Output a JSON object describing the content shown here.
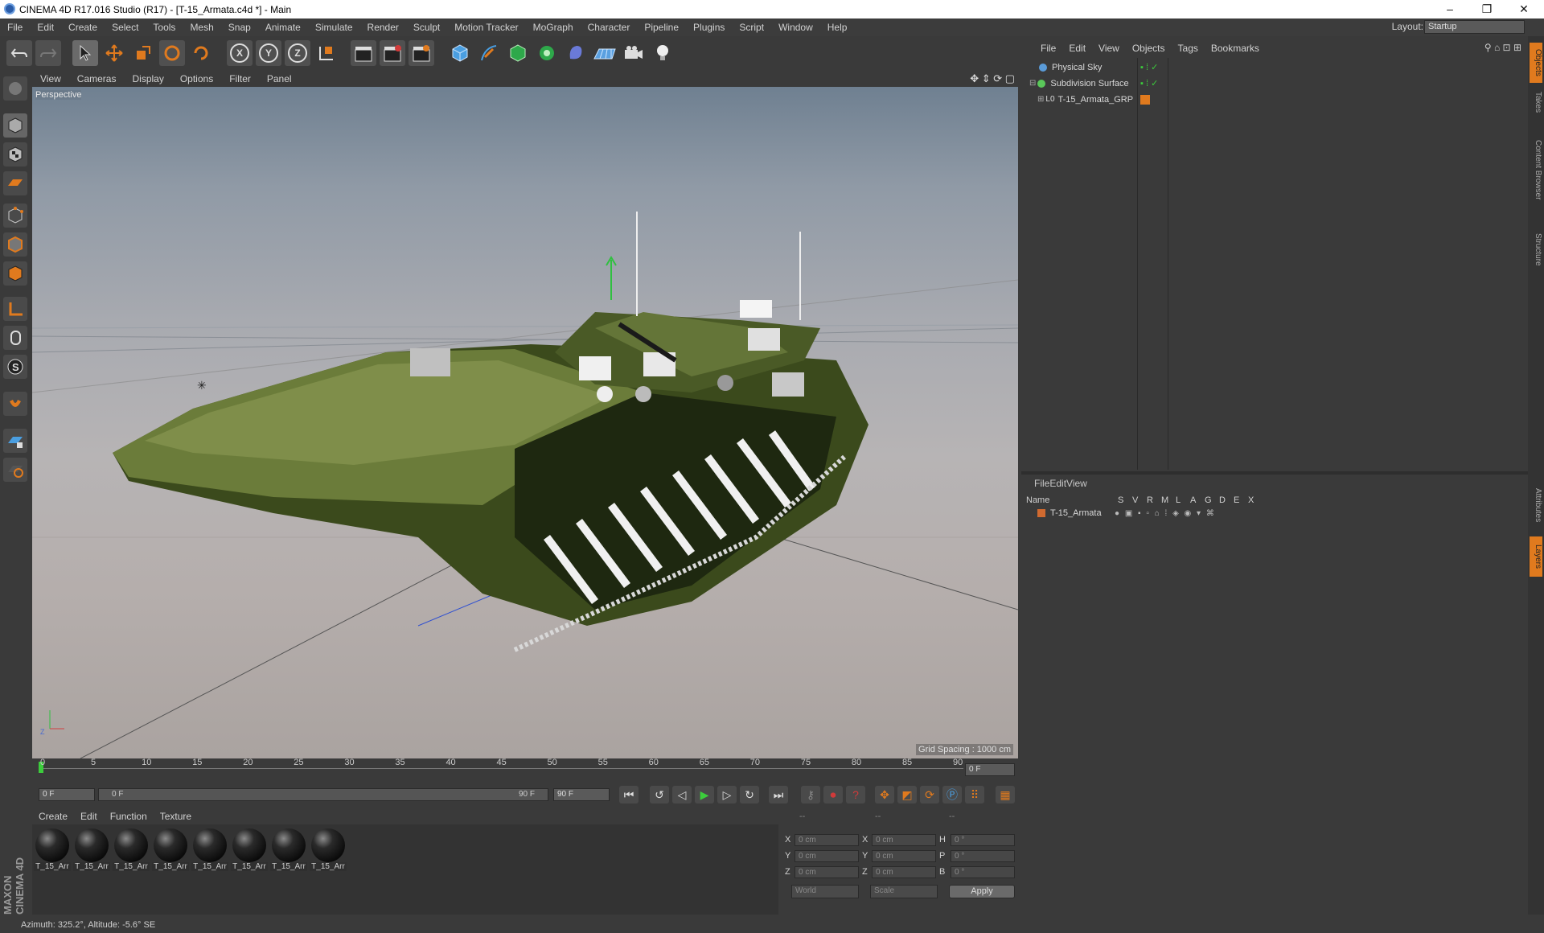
{
  "window": {
    "title": "CINEMA 4D R17.016 Studio (R17) - [T-15_Armata.c4d *] - Main",
    "minimize": "–",
    "maximize": "❐",
    "close": "✕"
  },
  "menubar": [
    "File",
    "Edit",
    "Create",
    "Select",
    "Tools",
    "Mesh",
    "Snap",
    "Animate",
    "Simulate",
    "Render",
    "Sculpt",
    "Motion Tracker",
    "MoGraph",
    "Character",
    "Pipeline",
    "Plugins",
    "Script",
    "Window",
    "Help"
  ],
  "layout": {
    "label": "Layout:",
    "value": "Startup"
  },
  "toolbar_axes": [
    "X",
    "Y",
    "Z"
  ],
  "viewport": {
    "menu": [
      "View",
      "Cameras",
      "Display",
      "Options",
      "Filter",
      "Panel"
    ],
    "label": "Perspective",
    "grid_spacing": "Grid Spacing : 1000 cm",
    "axis_z": "Z"
  },
  "timeline": {
    "ticks": [
      "0",
      "5",
      "10",
      "15",
      "20",
      "25",
      "30",
      "35",
      "40",
      "45",
      "50",
      "55",
      "60",
      "65",
      "70",
      "75",
      "80",
      "85",
      "90"
    ],
    "current_frame": "0 F",
    "start_field": "0 F",
    "range_start": "0 F",
    "range_end": "90 F",
    "end_field": "90 F"
  },
  "materials": {
    "menu": [
      "Create",
      "Edit",
      "Function",
      "Texture"
    ],
    "items": [
      "T_15_Arr",
      "T_15_Arr",
      "T_15_Arr",
      "T_15_Arr",
      "T_15_Arr",
      "T_15_Arr",
      "T_15_Arr",
      "T_15_Arr"
    ]
  },
  "coords": {
    "headers": [
      "--",
      "--",
      "--"
    ],
    "rows": [
      {
        "a": "X",
        "av": "0 cm",
        "b": "X",
        "bv": "0 cm",
        "c": "H",
        "cv": "0 °"
      },
      {
        "a": "Y",
        "av": "0 cm",
        "b": "Y",
        "bv": "0 cm",
        "c": "P",
        "cv": "0 °"
      },
      {
        "a": "Z",
        "av": "0 cm",
        "b": "Z",
        "bv": "0 cm",
        "c": "B",
        "cv": "0 °"
      }
    ],
    "mode1": "World",
    "mode2": "Scale",
    "apply": "Apply"
  },
  "objects": {
    "menu": [
      "File",
      "Edit",
      "View",
      "Objects",
      "Tags",
      "Bookmarks"
    ],
    "items": [
      {
        "name": "Physical Sky",
        "color": "#5a9bd8"
      },
      {
        "name": "Subdivision Surface",
        "color": "#5ac85a"
      },
      {
        "name": "T-15_Armata_GRP",
        "color": "#aaaaaa"
      }
    ]
  },
  "layers": {
    "menu": [
      "File",
      "Edit",
      "View"
    ],
    "columns": [
      "Name",
      "S",
      "V",
      "R",
      "M",
      "L",
      "A",
      "G",
      "D",
      "E",
      "X"
    ],
    "items": [
      {
        "name": "T-15_Armata",
        "color": "#d06a30"
      }
    ]
  },
  "side_tabs": [
    "Objects",
    "Takes",
    "Content Browser",
    "Structure",
    "Attributes",
    "Layers"
  ],
  "brand": "MAXON CINEMA 4D",
  "status": "Azimuth: 325.2°, Altitude: -5.6°  SE",
  "colors": {
    "accent_orange": "#e07a1e",
    "accent_blue": "#4a9ee0",
    "play_green": "#3ccc3c",
    "record_red": "#d03a3a"
  }
}
